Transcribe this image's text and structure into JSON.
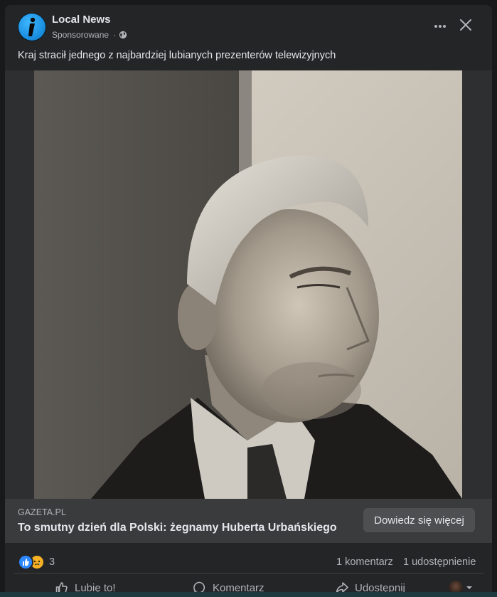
{
  "post": {
    "page_name": "Local News",
    "sponsored_label": "Sponsorowane",
    "separator": "·",
    "text": "Kraj stracił jednego z najbardziej lubianych prezenterów telewizyjnych",
    "icons": {
      "avatar": "info-i-icon",
      "audience": "globe-icon",
      "more": "ellipsis-icon",
      "close": "close-icon"
    }
  },
  "link": {
    "domain": "GAZETA.PL",
    "title": "To smutny dzień dla Polski: żegnamy Huberta Urbańskiego",
    "cta_label": "Dowiedz się więcej"
  },
  "stats": {
    "reaction_count": "3",
    "reactions": [
      "like",
      "sad"
    ],
    "comments": "1 komentarz",
    "shares": "1 udostępnienie"
  },
  "actions": {
    "like_label": "Lubię to!",
    "comment_label": "Komentarz",
    "share_label": "Udostępnij"
  },
  "colors": {
    "card_bg": "#242526",
    "link_bar_bg": "#3a3b3c",
    "cta_bg": "#4e4f50",
    "text_primary": "#e4e6eb",
    "text_secondary": "#b0b3b8",
    "like_blue": "#2d88ff",
    "sad_yellow": "#f7b125"
  }
}
